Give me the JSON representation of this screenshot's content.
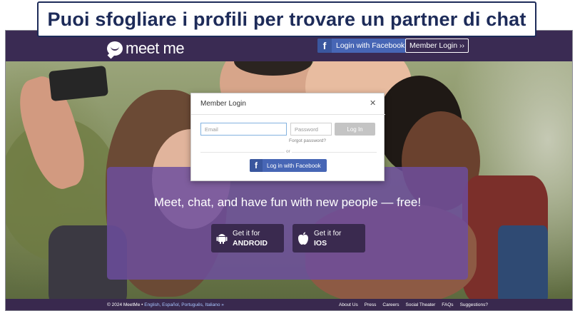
{
  "caption": "Puoi sfogliare i profili per trovare un partner di chat",
  "header": {
    "logo_text": "meet me",
    "facebook_login": "Login with Facebook",
    "member_login": "Member Login ››"
  },
  "modal": {
    "title": "Member Login",
    "close": "✕",
    "email_placeholder": "Email",
    "password_placeholder": "Password",
    "login_button": "Log In",
    "forgot": "Forgot password?",
    "or": "or",
    "facebook_button": "Log in with Facebook"
  },
  "promo": {
    "tagline": "Meet, chat, and have fun with new people — free!",
    "android_line1": "Get it for",
    "android_line2": "ANDROID",
    "ios_line1": "Get it for",
    "ios_line2": "IOS"
  },
  "footer": {
    "copyright": "© 2024 MeetMe • ",
    "languages": "English, Español, Português, Italiano »",
    "links": [
      "About Us",
      "Press",
      "Careers",
      "Social Theater",
      "FAQs",
      "Suggestions?"
    ]
  },
  "colors": {
    "header": "#3a2b53",
    "facebook": "#4766b5",
    "promo": "#6c4e9f",
    "caption_text": "#1d2b59"
  }
}
